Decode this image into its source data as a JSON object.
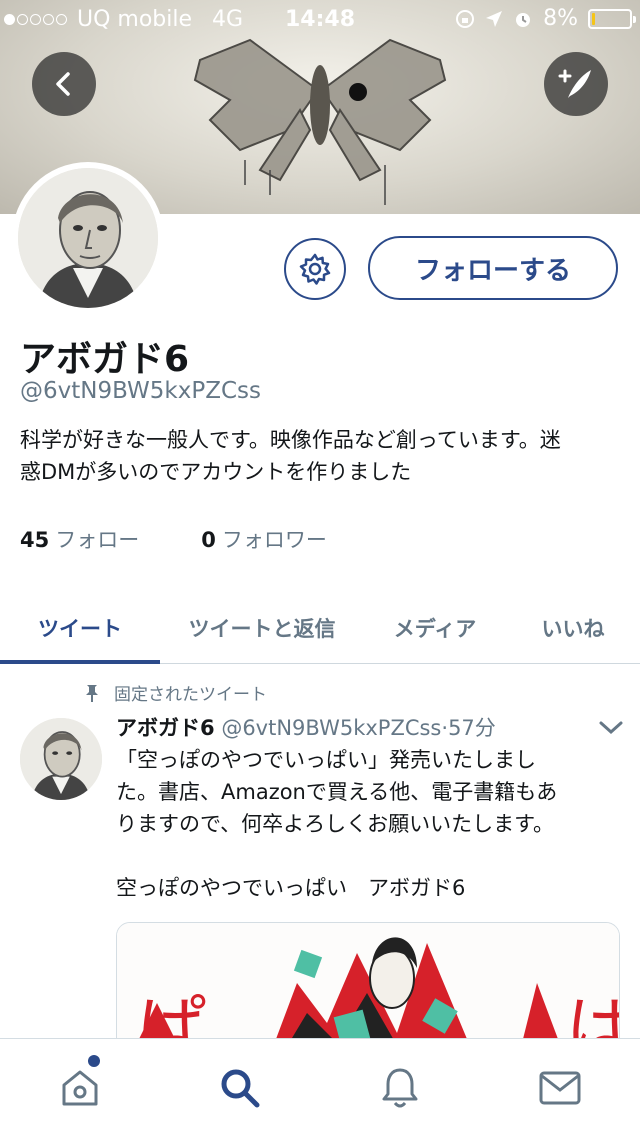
{
  "status_bar": {
    "carrier": "UQ mobile",
    "network": "4G",
    "time": "14:48",
    "battery": "8%",
    "battery_level": 0.08,
    "signal_dots": 5,
    "signal_filled": 1
  },
  "header": {
    "back_icon": "chevron-left-icon",
    "compose_icon": "compose-feather-icon"
  },
  "profile": {
    "display_name": "アボガド6",
    "handle": "@6vtN9BW5kxPZCss",
    "bio_line1": "科学が好きな一般人です。映像作品など創っています。迷",
    "bio_line2": "惑DMが多いのでアカウントを作りました",
    "follow_button": "フォローする",
    "following_count": "45",
    "following_label": "フォロー",
    "followers_count": "0",
    "followers_label": "フォロワー"
  },
  "tabs": [
    {
      "label": "ツイート"
    },
    {
      "label": "ツイートと返信"
    },
    {
      "label": "メディア"
    },
    {
      "label": "いいね"
    }
  ],
  "tweet": {
    "pinned_label": "固定されたツイート",
    "author": "アボガド6",
    "handle": "@6vtN9BW5kxPZCss",
    "separator": "·",
    "time": "57分",
    "line1": "「空っぽのやつでいっぱい」発売いたしまし",
    "line2": "た。書店、Amazonで買える他、電子書籍もあ",
    "line3": "りますので、何卒よろしくお願いいたします。",
    "line4": "空っぽのやつでいっぱい　アボガド6"
  },
  "colors": {
    "accent": "#2b4a8a",
    "muted": "#657786",
    "text": "#14171a",
    "battery": "#f5c518"
  },
  "bottom_nav": [
    {
      "icon": "home-icon"
    },
    {
      "icon": "search-icon"
    },
    {
      "icon": "bell-icon"
    },
    {
      "icon": "mail-icon"
    }
  ]
}
